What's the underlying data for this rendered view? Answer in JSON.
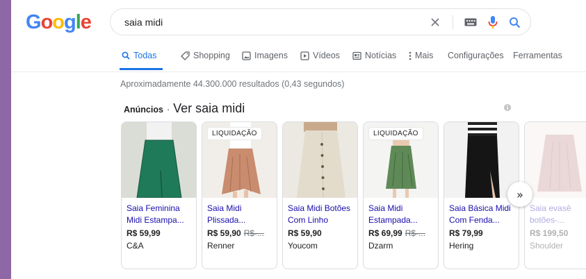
{
  "logo": {
    "letters": [
      "G",
      "o",
      "o",
      "g",
      "l",
      "e"
    ],
    "colors": [
      "#4285F4",
      "#EA4335",
      "#FBBC05",
      "#4285F4",
      "#34A853",
      "#EA4335"
    ]
  },
  "search": {
    "value": "saia midi",
    "clear_icon": "close-icon",
    "keyboard_icon": "keyboard-icon",
    "mic_icon": "mic-icon",
    "search_icon": "search-icon"
  },
  "tabs": [
    {
      "label": "Todas",
      "icon": "search-icon",
      "active": true
    },
    {
      "label": "Shopping",
      "icon": "tag-icon"
    },
    {
      "label": "Imagens",
      "icon": "image-icon"
    },
    {
      "label": "Vídeos",
      "icon": "play-icon"
    },
    {
      "label": "Notícias",
      "icon": "news-icon"
    },
    {
      "label": "Mais",
      "icon": "more-vert-icon"
    },
    {
      "label": "Configurações"
    },
    {
      "label": "Ferramentas"
    }
  ],
  "stats": "Aproximadamente 44.300.000 resultados (0,43 segundos)",
  "ads": {
    "label": "Anúncios",
    "separator": "·",
    "title": "Ver saia midi"
  },
  "products": [
    {
      "title1": "Saia Feminina",
      "title2": "Midi Estampa...",
      "price": "R$ 59,99",
      "old_price": "",
      "merchant": "C&A",
      "badge": ""
    },
    {
      "title1": "Saia Midi",
      "title2": "Plissada...",
      "price": "R$ 59,90",
      "old_price": "R$-...",
      "merchant": "Renner",
      "badge": "LIQUIDAÇÃO"
    },
    {
      "title1": "Saia Midi Botões",
      "title2": "Com Linho",
      "price": "R$ 59,90",
      "old_price": "",
      "merchant": "Youcom",
      "badge": ""
    },
    {
      "title1": "Saia Midi",
      "title2": "Estampada...",
      "price": "R$ 69,99",
      "old_price": "R$-...",
      "merchant": "Dzarm",
      "badge": "LIQUIDAÇÃO"
    },
    {
      "title1": "Saia Básica Midi",
      "title2": "Com Fenda...",
      "price": "R$ 79,99",
      "old_price": "",
      "merchant": "Hering",
      "badge": ""
    },
    {
      "title1": "Saia evasê",
      "title2": "botões-...",
      "price": "R$ 199,50",
      "old_price": "",
      "merchant": "Shoulder",
      "badge": ""
    }
  ],
  "next_button": "»"
}
